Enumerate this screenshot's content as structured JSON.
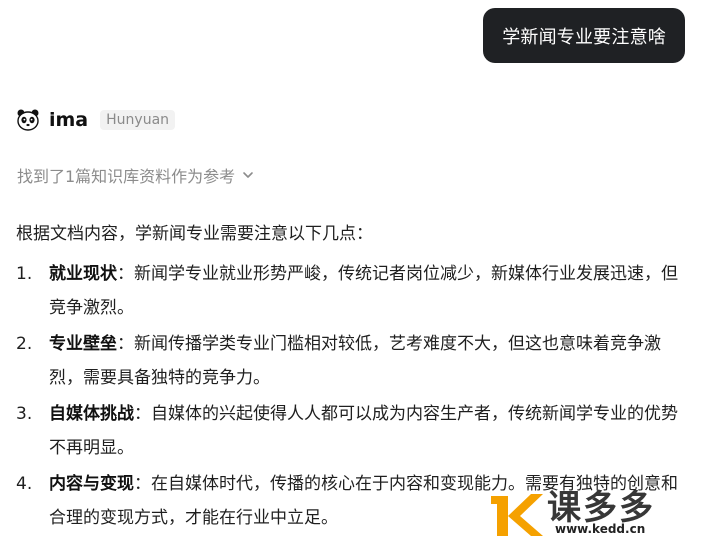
{
  "user_message": "学新闻专业要注意啥",
  "assistant": {
    "name": "ima",
    "model_tag": "Hunyuan",
    "avatar_icon": "panda-icon"
  },
  "references": {
    "label": "找到了1篇知识库资料作为参考",
    "icon": "chevron-down-icon"
  },
  "answer": {
    "intro": "根据文档内容，学新闻专业需要注意以下几点：",
    "items": [
      {
        "num": "1.",
        "title": "就业现状",
        "text": "：新闻学专业就业形势严峻，传统记者岗位减少，新媒体行业发展迅速，但竞争激烈。"
      },
      {
        "num": "2.",
        "title": "专业壁垒",
        "text": "：新闻传播学类专业门槛相对较低，艺考难度不大，但这也意味着竞争激烈，需要具备独特的竞争力。"
      },
      {
        "num": "3.",
        "title": "自媒体挑战",
        "text": "：自媒体的兴起使得人人都可以成为内容生产者，传统新闻学专业的优势不再明显。"
      },
      {
        "num": "4.",
        "title": "内容与变现",
        "text": "：在自媒体时代，传播的核心在于内容和变现能力。需要有独特的创意和合理的变现方式，才能在行业中立足。"
      }
    ]
  },
  "watermark": {
    "text": "课多多",
    "url": "www.kedd.cn"
  },
  "colors": {
    "bubble_bg": "#1f2124",
    "accent_orange": "#f5a100"
  }
}
